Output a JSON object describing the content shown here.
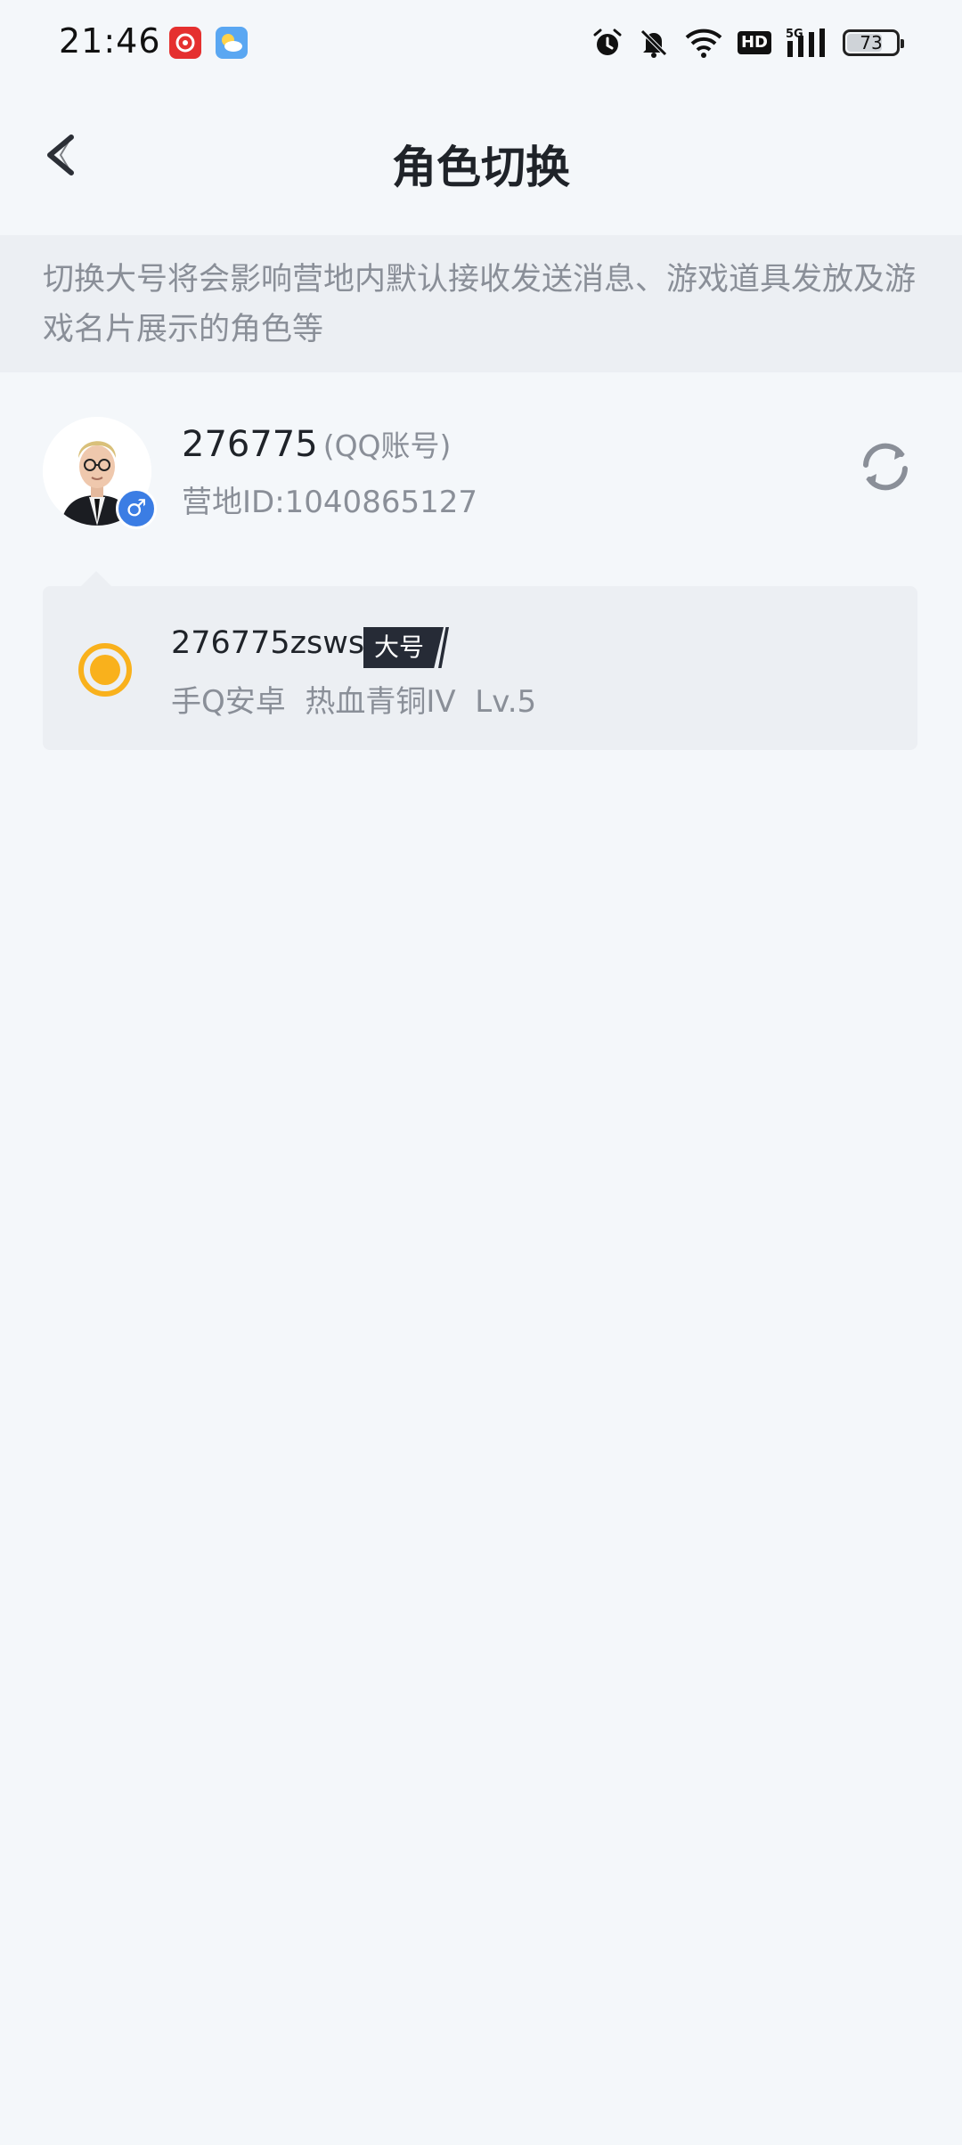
{
  "status_bar": {
    "time": "21:46",
    "battery": "73",
    "battery_level": 0.73,
    "hd": "HD",
    "network": "5G"
  },
  "header": {
    "title": "角色切换"
  },
  "notice": {
    "text": "切换大号将会影响营地内默认接收发送消息、游戏道具发放及游戏名片展示的角色等"
  },
  "account": {
    "name": "276775",
    "type": "(QQ账号)",
    "camp_id": "营地ID:1040865127",
    "gender": "♂"
  },
  "role": {
    "name": "276775zsws",
    "tag": "大号",
    "info": "手Q安卓  热血青铜IV  Lv.5",
    "selected": true
  },
  "colors": {
    "background": "#f4f7fa",
    "notice_bg": "#eceff3",
    "accent": "#f9b11c",
    "gender_badge": "#3b7de4",
    "tag_bg": "#262b36"
  },
  "icons": {
    "back": "chevron-left-icon",
    "switch": "refresh-icon",
    "alarm": "alarm-icon",
    "mute": "bell-off-icon",
    "wifi": "wifi-icon",
    "signal": "signal-icon"
  }
}
